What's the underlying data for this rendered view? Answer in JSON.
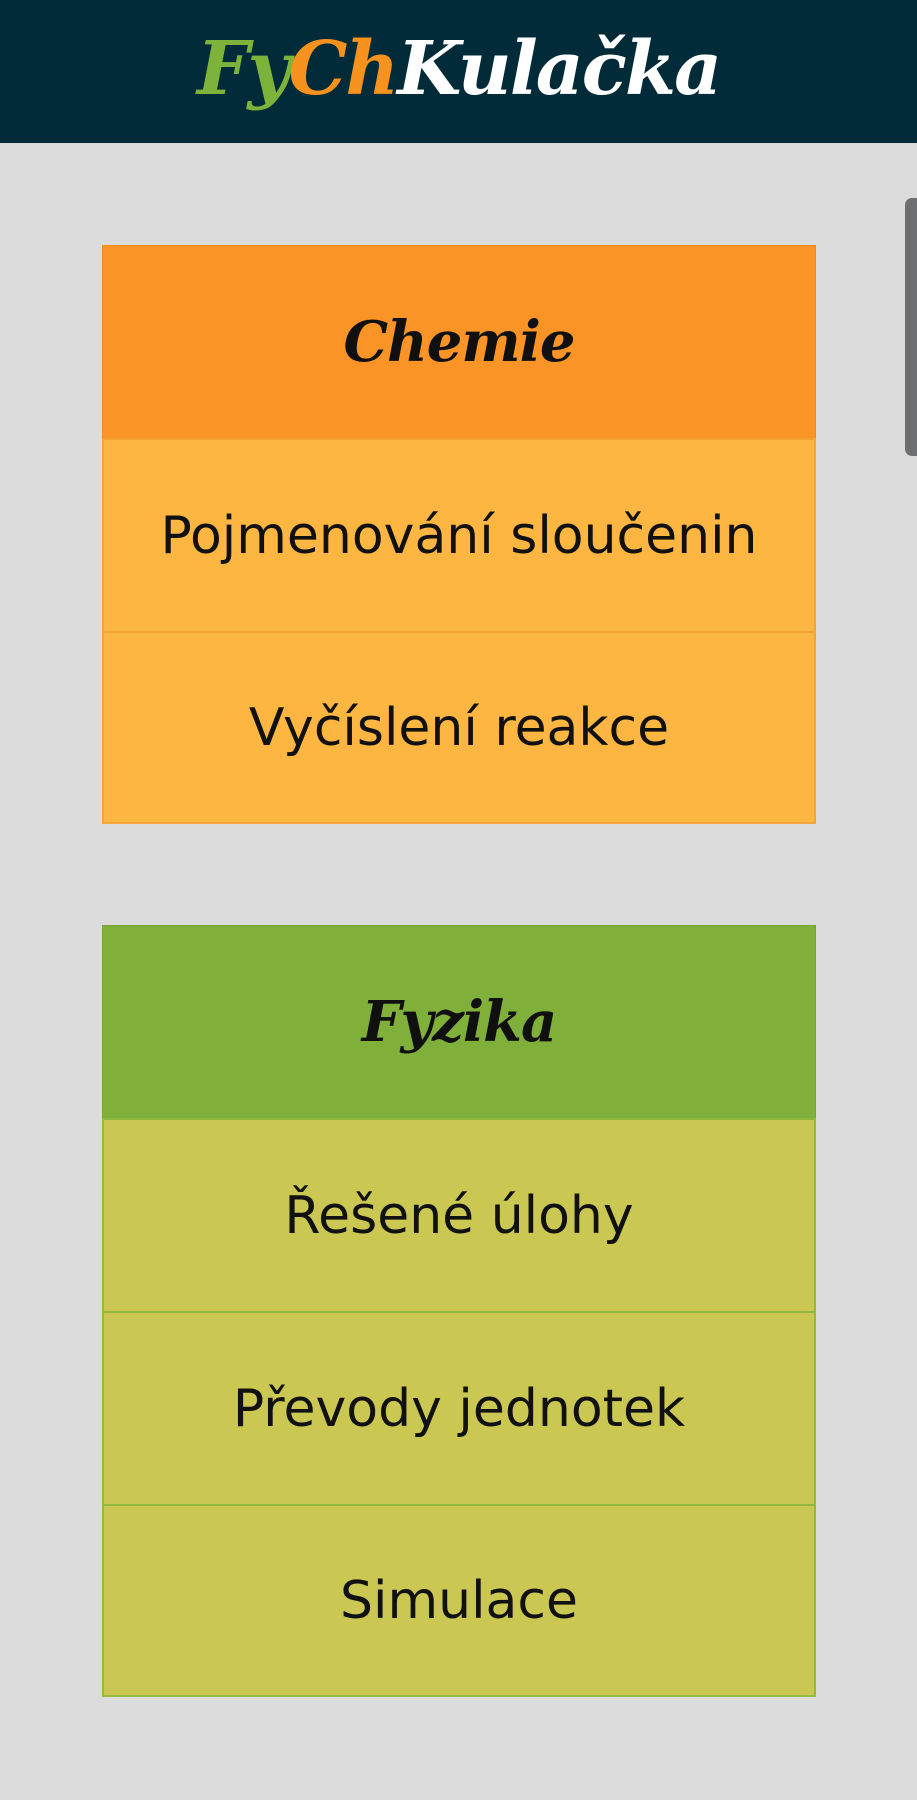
{
  "header": {
    "logo_part1": "Fy",
    "logo_part2": "Ch",
    "logo_part3": "Kulačka"
  },
  "colors": {
    "header_bg": "#022b3a",
    "logo_fy": "#7db33a",
    "logo_ch": "#f7921e",
    "chemie_header": "#fa9427",
    "chemie_item": "#fdb641",
    "fyzika_header": "#80b03a",
    "fyzika_item": "#cbc753",
    "background": "#dbdcdb"
  },
  "sections": {
    "chemie": {
      "title": "Chemie",
      "items": [
        {
          "label": "Pojmenování sloučenin"
        },
        {
          "label": "Vyčíslení reakce"
        }
      ]
    },
    "fyzika": {
      "title": "Fyzika",
      "items": [
        {
          "label": "Řešené úlohy"
        },
        {
          "label": "Převody jednotek"
        },
        {
          "label": "Simulace"
        }
      ]
    }
  }
}
